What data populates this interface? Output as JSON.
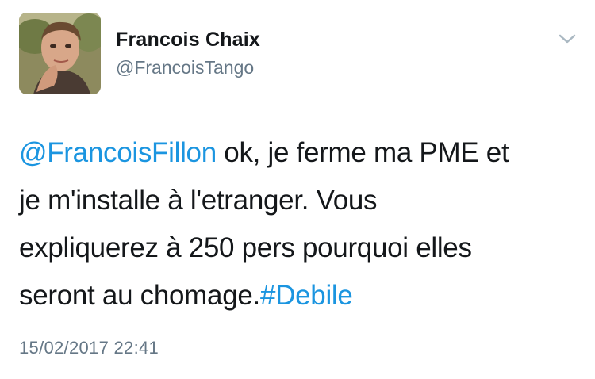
{
  "author": {
    "display_name": "Francois Chaix",
    "handle": "@FrancoisTango",
    "avatar": "profile-photo"
  },
  "menu": {
    "icon": "chevron-down-icon"
  },
  "tweet": {
    "mention": "@FrancoisFillon",
    "line1_text": " ok, je ferme ma PME et",
    "line2": "je m'installe à l'etranger. Vous",
    "line3": "expliquerez à 250 pers pourquoi elles",
    "line4_text": "seront au chomage.",
    "hashtag": "#Debile",
    "timestamp": "15/02/2017 22:41"
  },
  "colors": {
    "link": "#1b95e0",
    "text": "#14171a",
    "secondary": "#657786"
  }
}
